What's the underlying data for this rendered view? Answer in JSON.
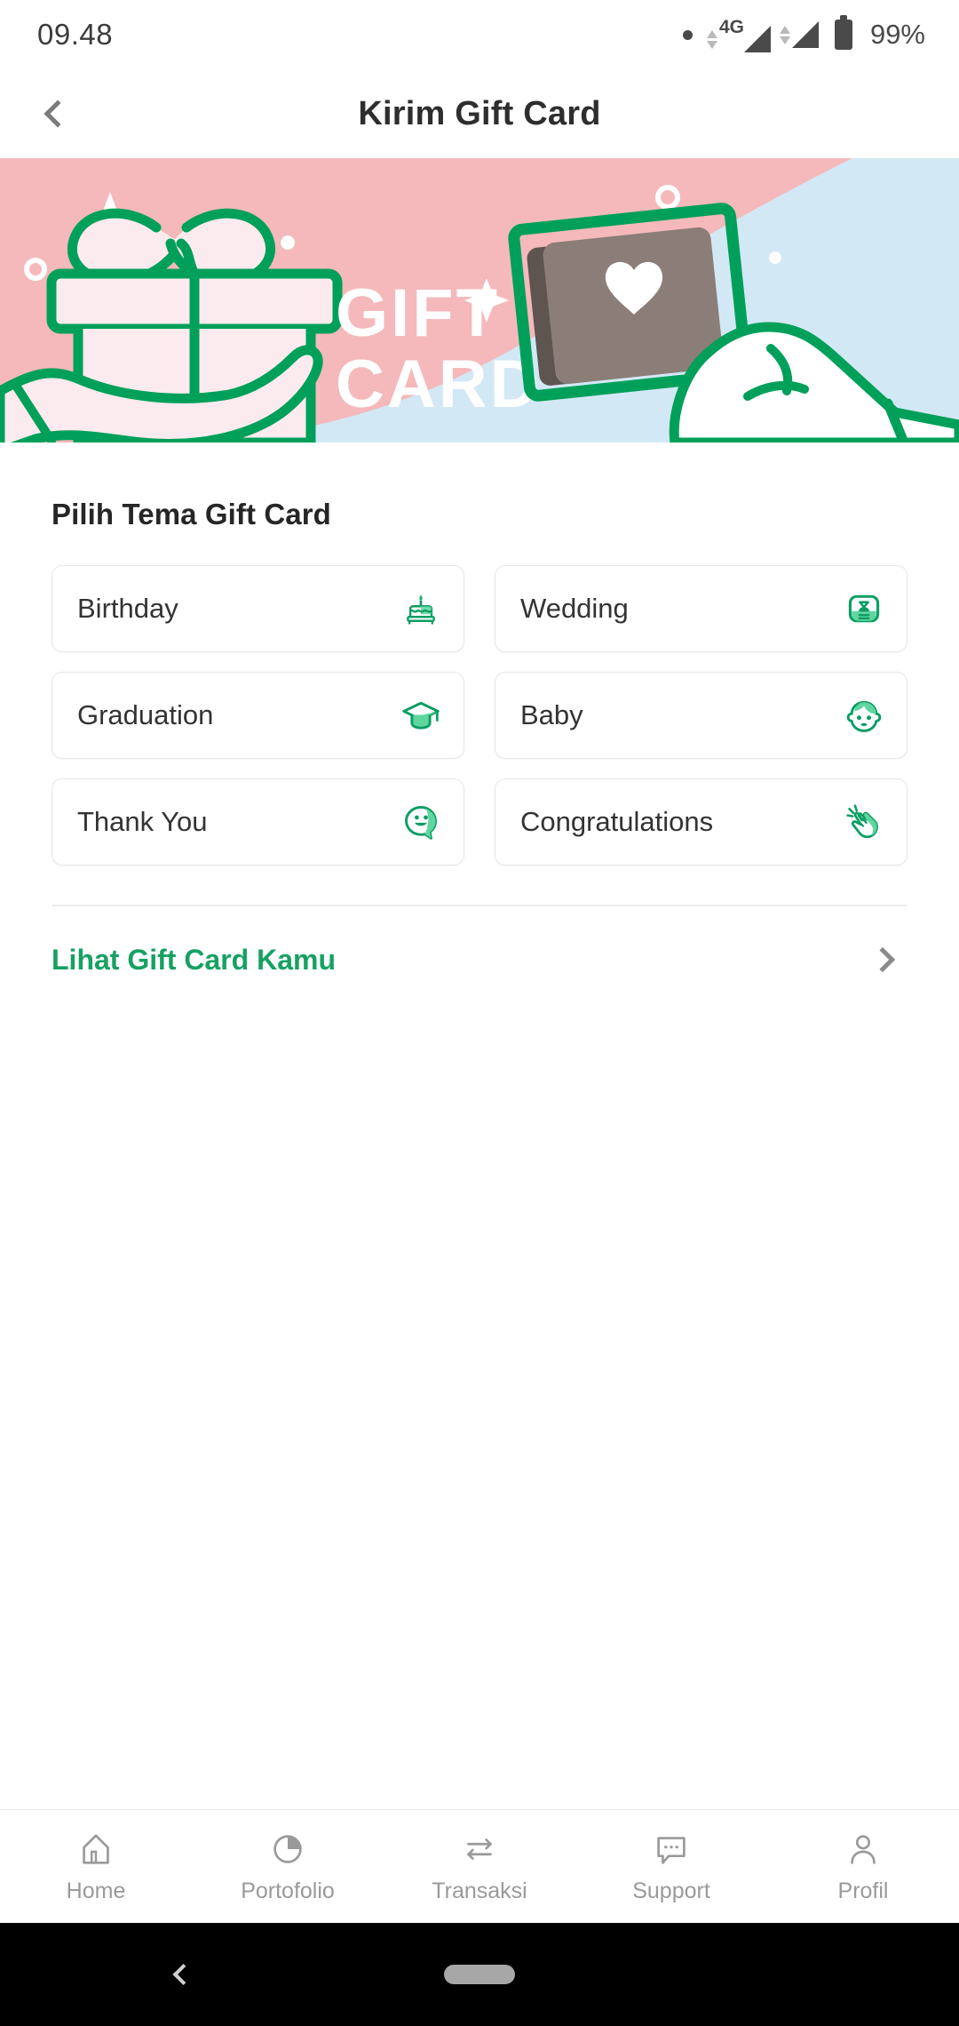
{
  "status_bar": {
    "time": "09.48",
    "network_type": "4G",
    "battery_percent": "99%",
    "icons": [
      "dot-icon",
      "data-arrows-icon",
      "signal-bars-icon",
      "signal-bars-icon",
      "battery-icon"
    ]
  },
  "header": {
    "title": "Kirim Gift Card",
    "back_icon": "chevron-left-icon"
  },
  "banner": {
    "headline_line1": "GIFT",
    "headline_line2": "CARD",
    "colors": {
      "pink": "#f5b9bb",
      "blue": "#d3e8f5",
      "green": "#00a05a",
      "card_grey": "#8b7d78",
      "card_grey_dark": "#5e5450",
      "light_pink": "#fcebee"
    },
    "illustration": "gift-card-hands-illustration"
  },
  "main": {
    "section_title": "Pilih Tema Gift Card",
    "themes": [
      {
        "label": "Birthday",
        "icon": "birthday-cake-icon"
      },
      {
        "label": "Wedding",
        "icon": "contact-card-icon"
      },
      {
        "label": "Graduation",
        "icon": "graduation-cap-icon"
      },
      {
        "label": "Baby",
        "icon": "baby-face-icon"
      },
      {
        "label": "Thank You",
        "icon": "smiley-chat-bubble-icon"
      },
      {
        "label": "Congratulations",
        "icon": "clapping-hands-icon"
      }
    ],
    "link": {
      "label": "Lihat Gift Card Kamu",
      "chevron_icon": "chevron-right-icon",
      "color": "#16a163"
    }
  },
  "bottom_nav": {
    "items": [
      {
        "label": "Home",
        "icon": "home-icon"
      },
      {
        "label": "Portofolio",
        "icon": "pie-chart-icon"
      },
      {
        "label": "Transaksi",
        "icon": "transfer-arrows-icon"
      },
      {
        "label": "Support",
        "icon": "chat-bubble-icon"
      },
      {
        "label": "Profil",
        "icon": "person-icon"
      }
    ]
  },
  "system_nav": {
    "back_icon": "system-back-icon",
    "home_pill": "home-pill-indicator"
  }
}
